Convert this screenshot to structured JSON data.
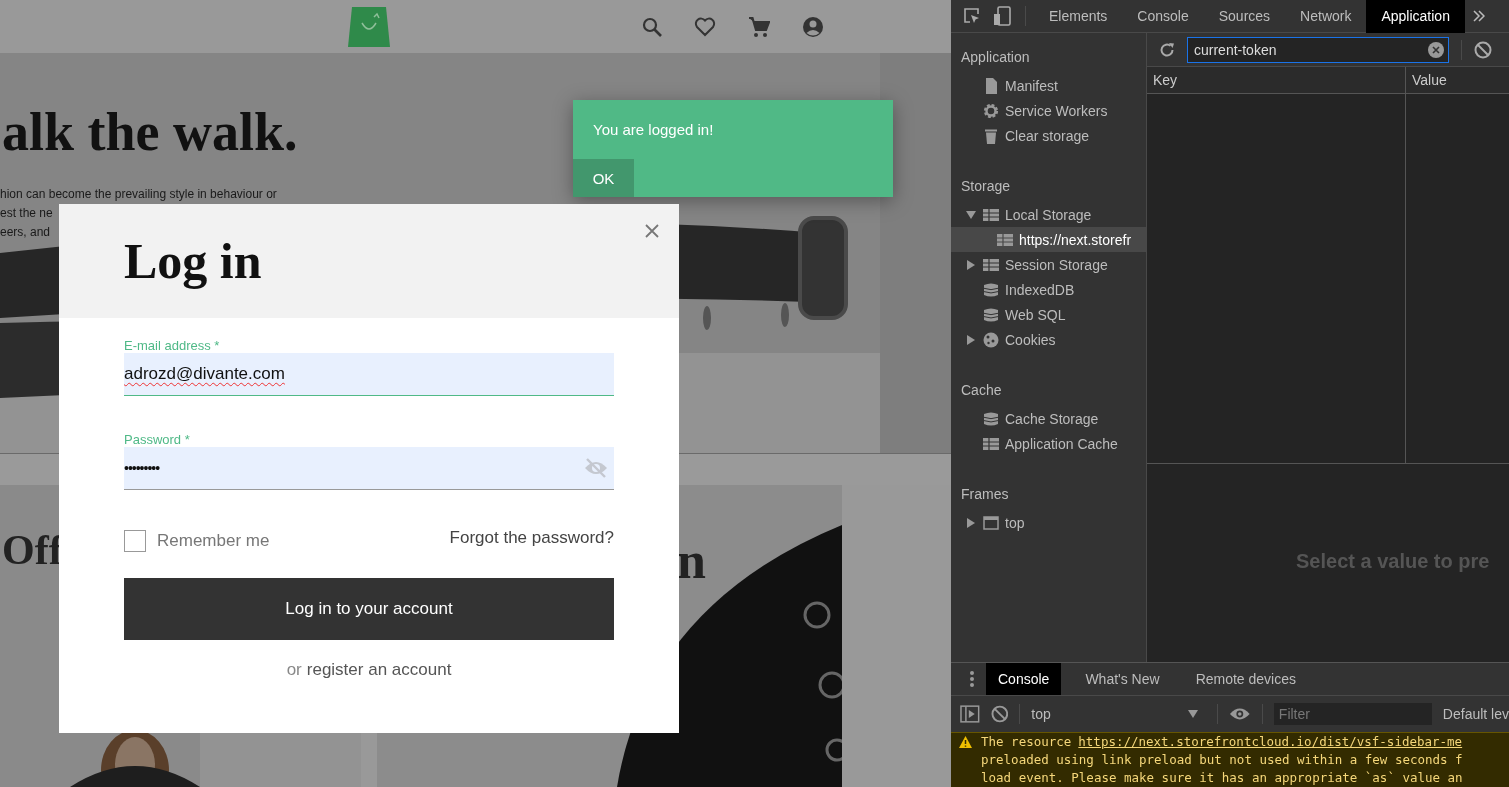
{
  "storefront": {
    "hero": {
      "title": "alk the walk.",
      "text_lines": [
        "hion can become the prevailing style in behaviour or",
        "est the ne",
        "eers, and"
      ]
    },
    "cards": [
      {
        "kind": "picture",
        "title": "Off"
      },
      {
        "kind": "picture",
        "title": "n"
      }
    ],
    "toast": {
      "message": "You are logged in!",
      "action": "OK"
    },
    "login_modal": {
      "title": "Log in",
      "fields": [
        {
          "kind": "text",
          "label": "E-mail address *",
          "value": "adrozd@divante.com"
        },
        {
          "kind": "password",
          "label": "Password *",
          "value": "•••••••••"
        }
      ],
      "remember_me": {
        "label": "Remember me",
        "checked": false
      },
      "forgot_link": "Forgot the password?",
      "submit": "Log in to your account",
      "register": {
        "prefix": "or",
        "link": "register an account"
      }
    }
  },
  "devtools": {
    "tabs": [
      {
        "label": "Elements",
        "selected": false
      },
      {
        "label": "Console",
        "selected": false
      },
      {
        "label": "Sources",
        "selected": false
      },
      {
        "label": "Network",
        "selected": false
      },
      {
        "label": "Application",
        "selected": true
      }
    ],
    "sidebar": {
      "sections": [
        {
          "title": "Application",
          "items": [
            {
              "label": "Manifest",
              "kind": "file",
              "selected": false
            },
            {
              "label": "Service Workers",
              "kind": "gear",
              "selected": false
            },
            {
              "label": "Clear storage",
              "kind": "trash",
              "selected": false
            }
          ]
        },
        {
          "title": "Storage",
          "items": [
            {
              "label": "Local Storage",
              "kind": "grid",
              "selected": false,
              "expanded": true,
              "children": [
                {
                  "label": "https://next.storefr",
                  "kind": "grid",
                  "selected": true
                }
              ]
            },
            {
              "label": "Session Storage",
              "kind": "grid",
              "selected": false,
              "expanded": false
            },
            {
              "label": "IndexedDB",
              "kind": "database",
              "selected": false
            },
            {
              "label": "Web SQL",
              "kind": "database",
              "selected": false
            },
            {
              "label": "Cookies",
              "kind": "cookie",
              "selected": false,
              "expanded": false
            }
          ]
        },
        {
          "title": "Cache",
          "items": [
            {
              "label": "Cache Storage",
              "kind": "database",
              "selected": false
            },
            {
              "label": "Application Cache",
              "kind": "grid",
              "selected": false
            }
          ]
        },
        {
          "title": "Frames",
          "items": [
            {
              "label": "top",
              "kind": "frame",
              "selected": false,
              "expanded": false
            }
          ]
        }
      ]
    },
    "filter": {
      "value": "current-token"
    },
    "table": {
      "columns": [
        "Key",
        "Value"
      ]
    },
    "preview": "Select a value to pre",
    "drawer": {
      "tabs": [
        {
          "label": "Console",
          "selected": true
        },
        {
          "label": "What's New",
          "selected": false
        },
        {
          "label": "Remote devices",
          "selected": false
        }
      ],
      "context": "top",
      "filter_placeholder": "Filter",
      "levels": "Default lev",
      "warning": {
        "prefix": "The resource",
        "link": "https://next.storefrontcloud.io/dist/vsf-sidebar-me",
        "lines": [
          "preloaded using link preload but not used within a few seconds f",
          "load event. Please make sure it has an appropriate `as` value an"
        ]
      }
    }
  }
}
